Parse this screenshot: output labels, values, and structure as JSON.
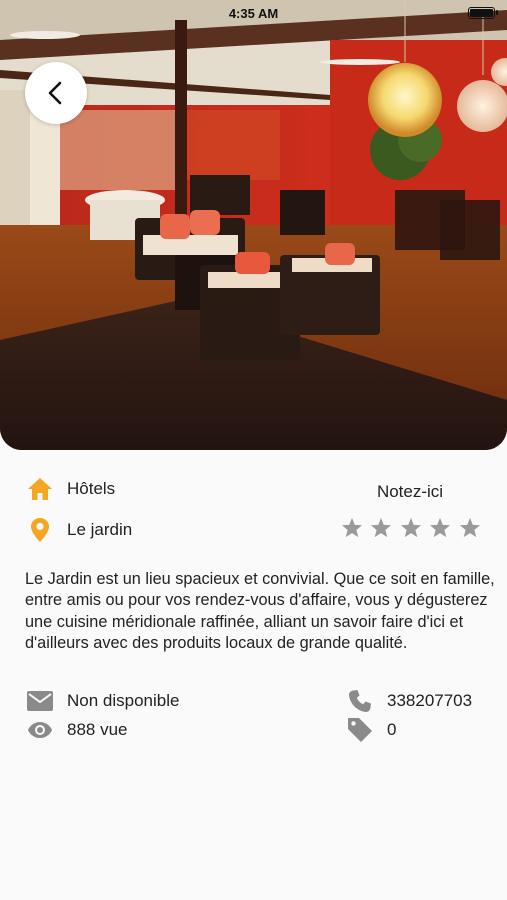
{
  "status_bar": {
    "time": "4:35 AM"
  },
  "colors": {
    "accent": "#f5a623",
    "icon_grey": "#8a8a8a",
    "star_grey": "#9a9a9a",
    "text": "#222222"
  },
  "place": {
    "category": "Hôtels",
    "category_icon": "home-icon",
    "location": "Le jardin",
    "location_icon": "map-pin-icon",
    "description": "Le Jardin est un lieu spacieux et convivial. Que ce soit en famille, entre amis ou pour vos rendez-vous d'affaire, vous y dégusterez une cuisine méridionale raffinée, alliant un savoir faire d'ici et d'ailleurs avec des produits locaux de grande qualité."
  },
  "rating": {
    "label": "Notez-ici",
    "max_stars": 5,
    "value": 0
  },
  "details": {
    "email": "Non disponible",
    "email_icon": "mail-icon",
    "views": "888 vue",
    "views_icon": "eye-icon",
    "phone": "338207703",
    "phone_icon": "phone-icon",
    "tags": "0",
    "tags_icon": "tag-icon"
  }
}
